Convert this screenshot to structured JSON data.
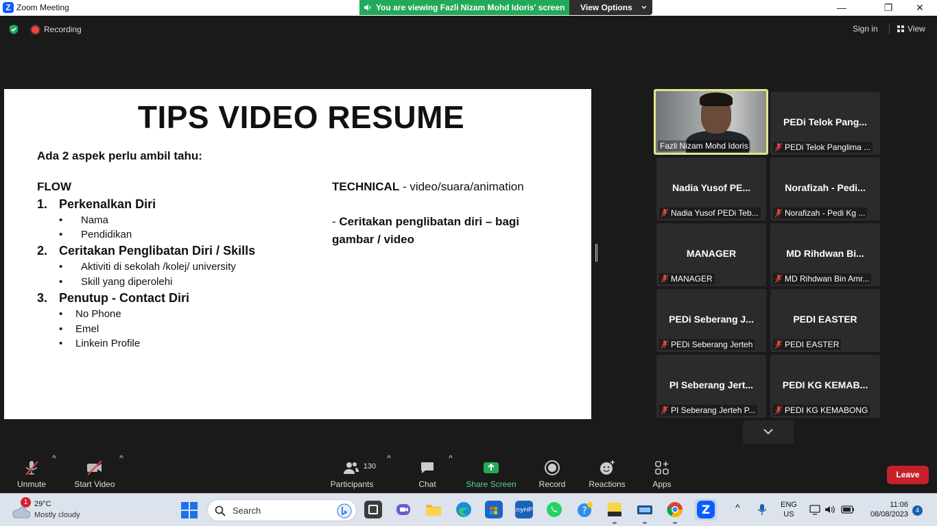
{
  "window": {
    "title": "Zoom Meeting",
    "logo_letter": "Z",
    "minimize": "—",
    "restore": "❐",
    "close": "✕"
  },
  "banner": {
    "viewing_text": "You are viewing Fazli Nizam Mohd Idoris' screen",
    "view_options": "View Options"
  },
  "topbar": {
    "recording": "Recording",
    "sign_in": "Sign in",
    "view": "View"
  },
  "slide": {
    "title": "TIPS VIDEO RESUME",
    "intro": "Ada 2 aspek perlu ambil tahu:",
    "flow_heading": "FLOW",
    "sections": [
      {
        "num": "1.",
        "heading": "Perkenalkan Diri",
        "bullets": [
          "Nama",
          "Pendidikan"
        ]
      },
      {
        "num": "2.",
        "heading": "Ceritakan Penglibatan Diri / Skills",
        "bullets": [
          "Aktiviti di sekolah /kolej/ university",
          "Skill yang diperolehi"
        ]
      },
      {
        "num": "3.",
        "heading": "Penutup - Contact Diri",
        "bullets": [
          "No Phone",
          "Emel",
          "Linkein Profile"
        ]
      }
    ],
    "technical_heading": "TECHNICAL",
    "technical_detail": " - video/suara/animation",
    "technical_note_dash": "- ",
    "technical_note_line1": "Ceritakan penglibatan diri – bagi",
    "technical_note_line2": "gambar / video"
  },
  "participants": [
    {
      "name": "",
      "label": "Fazli Nizam Mohd Idoris",
      "active": true,
      "muted": false
    },
    {
      "name": "PEDi Telok Pang...",
      "label": "PEDi Telok Panglima ...",
      "muted": true
    },
    {
      "name": "Nadia Yusof PE...",
      "label": "Nadia Yusof PEDi Teb...",
      "muted": true
    },
    {
      "name": "Norafizah - Pedi...",
      "label": "Norafizah - Pedi Kg ...",
      "muted": true
    },
    {
      "name": "MANAGER",
      "label": "MANAGER",
      "muted": true
    },
    {
      "name": "MD Rihdwan Bi...",
      "label": "MD Rihdwan Bin Amr...",
      "muted": true
    },
    {
      "name": "PEDi Seberang J...",
      "label": "PEDi Seberang Jerteh",
      "muted": true
    },
    {
      "name": "PEDI EASTER",
      "label": "PEDI EASTER",
      "muted": true
    },
    {
      "name": "PI Seberang Jert...",
      "label": "PI Seberang Jerteh P...",
      "muted": true
    },
    {
      "name": "PEDI KG KEMAB...",
      "label": "PEDI KG KEMABONG",
      "muted": true
    }
  ],
  "toolbar": {
    "unmute": "Unmute",
    "start_video": "Start Video",
    "participants": "Participants",
    "participant_count": "130",
    "chat": "Chat",
    "share_screen": "Share Screen",
    "record": "Record",
    "reactions": "Reactions",
    "apps": "Apps",
    "leave": "Leave",
    "caret": "^"
  },
  "taskbar": {
    "weather_badge": "1",
    "temperature": "29°C",
    "condition": "Mostly cloudy",
    "search_placeholder": "Search",
    "lang_line1": "ENG",
    "lang_line2": "US",
    "time": "11:06",
    "date": "08/08/2023",
    "notification_count": "4",
    "tray_chevron": "^"
  },
  "colors": {
    "accent_green": "#23a95a",
    "leave_red": "#c8202b",
    "active_speaker": "#e5e48a",
    "muted_red": "#e0453a"
  }
}
